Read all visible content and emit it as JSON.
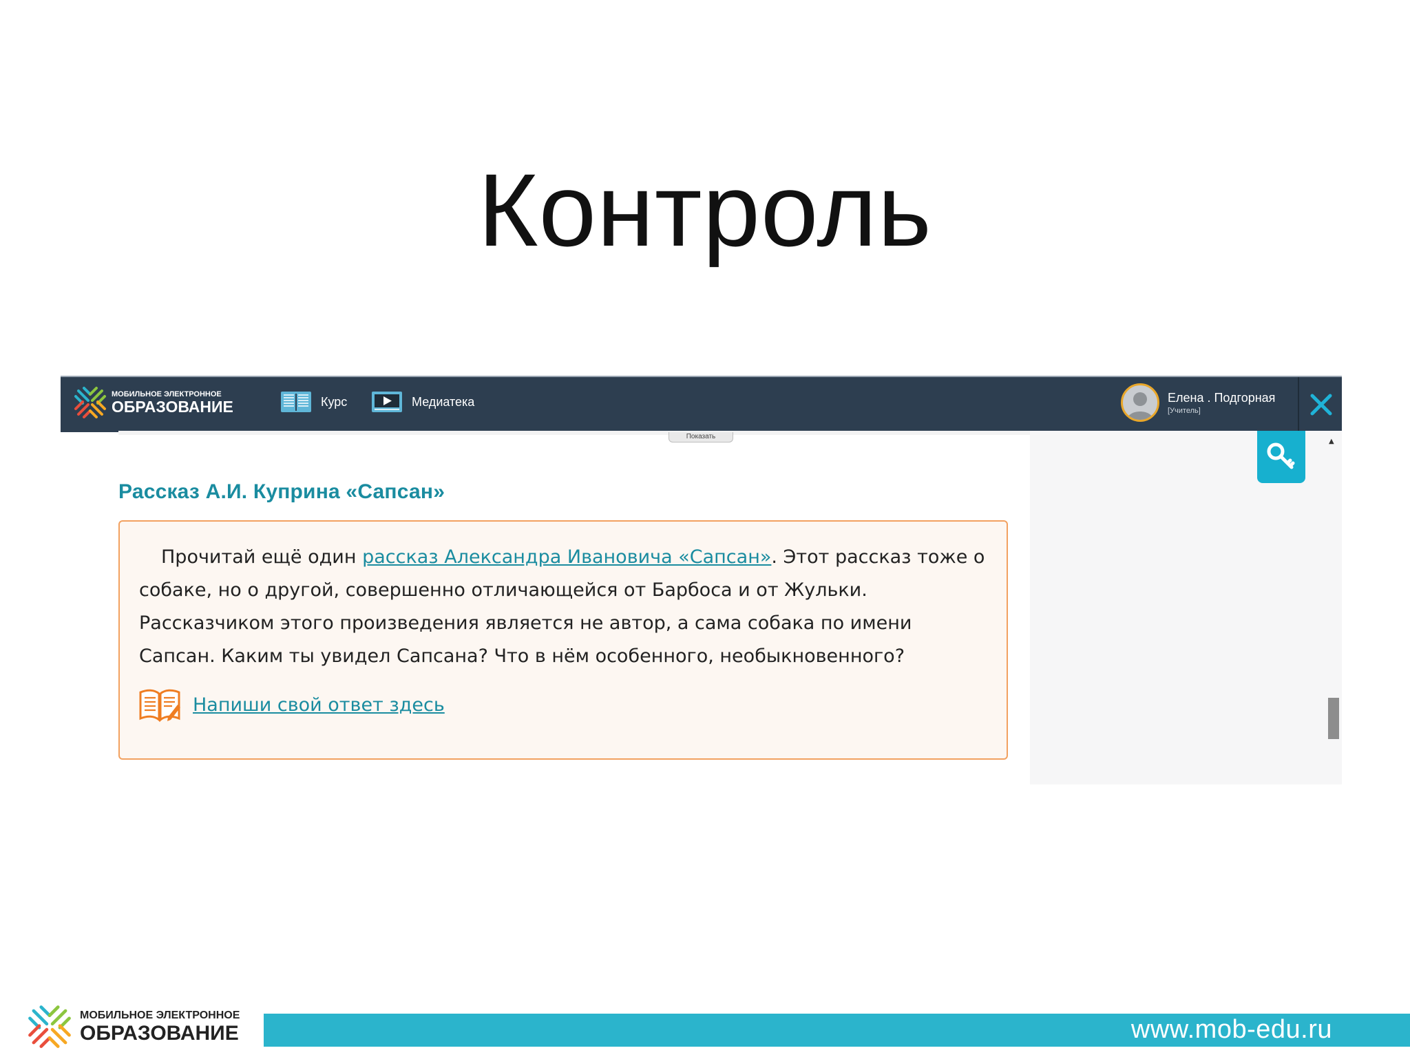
{
  "slide": {
    "title": "Контроль"
  },
  "app": {
    "logo": {
      "line1": "МОБИЛЬНОЕ ЭЛЕКТРОННОЕ",
      "line2": "ОБРАЗОВАНИЕ"
    },
    "nav": [
      {
        "label": "Курс",
        "icon": "book-icon"
      },
      {
        "label": "Медиатека",
        "icon": "video-player-icon"
      }
    ],
    "user": {
      "name": "Елена . Подгорная",
      "role": "[Учитель]"
    },
    "show_tab": "Показать",
    "section_heading": "Рассказ А.И. Куприна «Сапсан»",
    "task": {
      "text_before_link": "Прочитай ещё один ",
      "link_text": "рассказ Александра Ивановича «Сапсан»",
      "text_after_link": ". Этот рассказ тоже о собаке, но о другой, совершенно отличающейся от Барбоса и от Жульки. Рассказчиком этого произведения является не автор, а сама собака по имени Сапсан. Каким ты увидел Сапсана? Что в нём особенного, необыкновенного?",
      "answer_link": "Напиши свой ответ здесь"
    }
  },
  "footer": {
    "logo": {
      "line1": "МОБИЛЬНОЕ ЭЛЕКТРОННОЕ",
      "line2": "ОБРАЗОВАНИЕ"
    },
    "url": "www.mob-edu.ru"
  },
  "colors": {
    "topbar": "#2d3e50",
    "accent": "#1a8ca0",
    "box_border": "#f2a160",
    "footer_bar": "#2bb4cc",
    "key_button": "#17b0cf"
  }
}
